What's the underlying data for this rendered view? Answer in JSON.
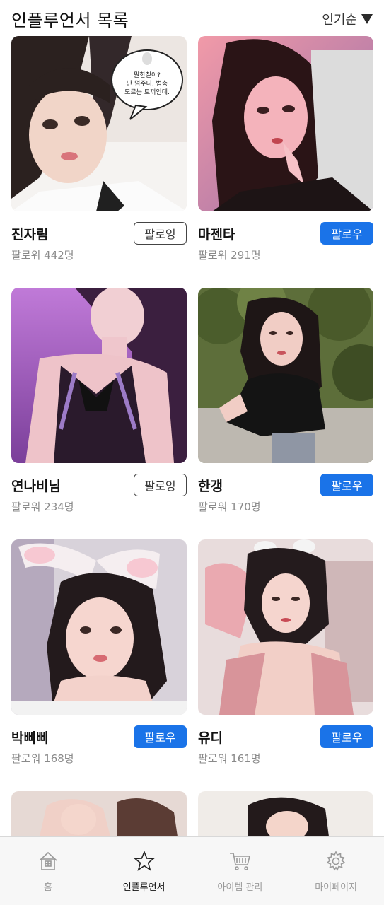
{
  "header": {
    "title": "인플루언서 목록",
    "sort_label": "인기순"
  },
  "influencers": [
    {
      "name": "진자림",
      "followers": "팔로워 442명",
      "button": "팔로잉",
      "following": true,
      "bubble": {
        "line1": "뭔한칠이?",
        "line2": "난 덤주니, 법충",
        "line3": "모르는 토끼인데."
      }
    },
    {
      "name": "마젠타",
      "followers": "팔로워 291명",
      "button": "팔로우",
      "following": false
    },
    {
      "name": "연나비님",
      "followers": "팔로워 234명",
      "button": "팔로잉",
      "following": true
    },
    {
      "name": "한갱",
      "followers": "팔로워 170명",
      "button": "팔로우",
      "following": false
    },
    {
      "name": "박삐삐",
      "followers": "팔로워 168명",
      "button": "팔로우",
      "following": false
    },
    {
      "name": "유디",
      "followers": "팔로워 161명",
      "button": "팔로우",
      "following": false
    }
  ],
  "nav": [
    {
      "label": "홈",
      "icon": "home-icon",
      "active": false
    },
    {
      "label": "인플루언서",
      "icon": "star-icon",
      "active": true
    },
    {
      "label": "아이템 관리",
      "icon": "cart-icon",
      "active": false
    },
    {
      "label": "마이페이지",
      "icon": "gear-icon",
      "active": false
    }
  ],
  "colors": {
    "follow_button": "#1a73e8",
    "follower_text": "#8a8a8a",
    "nav_background": "#f7f7f7"
  }
}
